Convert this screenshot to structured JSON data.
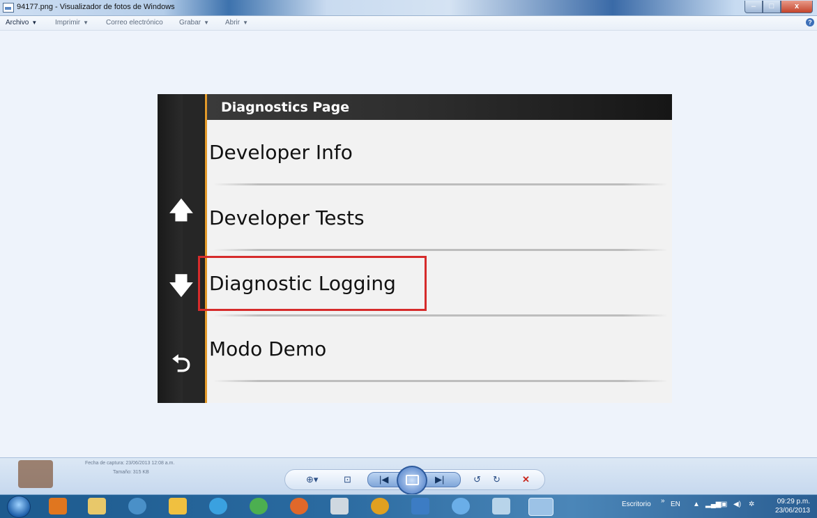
{
  "window": {
    "title": "94177.png - Visualizador de fotos de Windows",
    "buttons": {
      "minimize": "–",
      "maximize": "□",
      "close": "x"
    }
  },
  "menubar": {
    "items": [
      {
        "label": "Archivo"
      },
      {
        "label": "Imprimir"
      },
      {
        "label": "Correo electrónico"
      },
      {
        "label": "Grabar"
      },
      {
        "label": "Abrir"
      }
    ],
    "help": "?"
  },
  "device_screen": {
    "header": "Diagnostics Page",
    "items": [
      {
        "label": "Developer Info"
      },
      {
        "label": "Developer Tests"
      },
      {
        "label": "Diagnostic Logging",
        "highlighted": true
      },
      {
        "label": "Modo Demo"
      }
    ],
    "nav_icons": {
      "up": "up-arrow-icon",
      "down": "down-arrow-icon",
      "back": "back-icon"
    },
    "accent_color": "#e39a2a",
    "highlight_color": "#d62b2b"
  },
  "viewer_bar": {
    "info_line1": "Fecha de captura: 23/06/2013 12:08 a.m.",
    "info_line2": "Tamaño: 315 KB",
    "controls": {
      "zoom": "⊕▾",
      "actual_size": "⊡",
      "previous": "|◀",
      "next": "▶|",
      "rotate_left": "↺",
      "rotate_right": "↻",
      "delete": "✕"
    }
  },
  "taskbar": {
    "desktop_label": "Escritorio",
    "expand": "»",
    "language": "EN",
    "time": "09:29 p.m.",
    "date": "23/06/2013"
  }
}
